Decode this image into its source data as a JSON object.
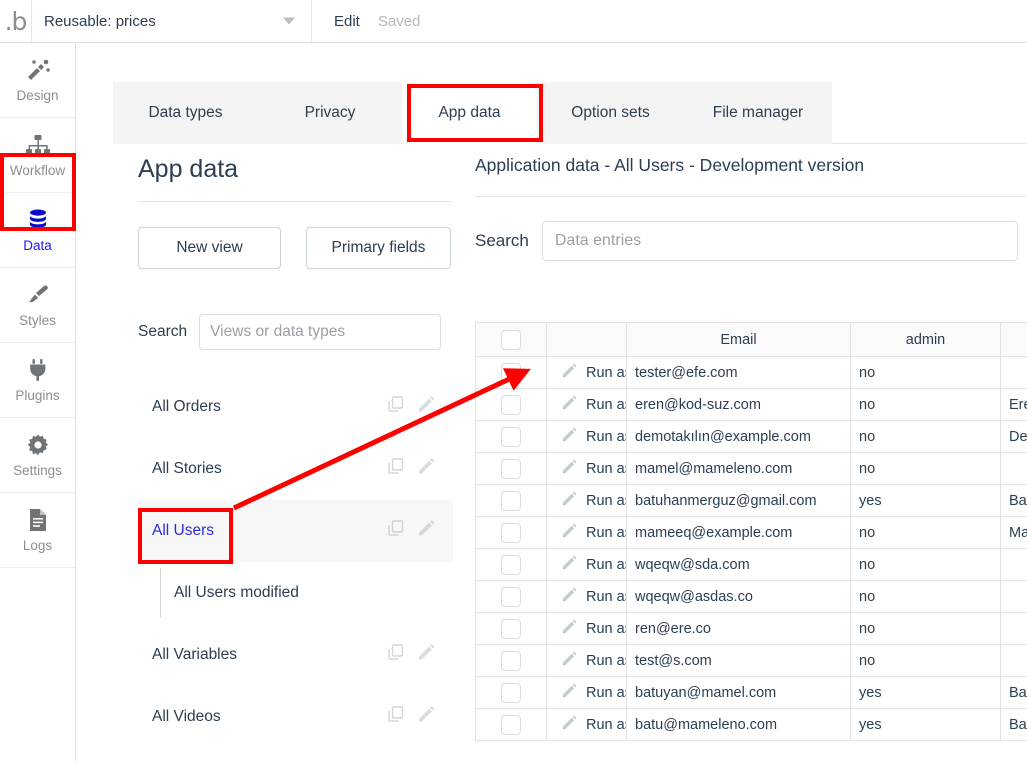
{
  "topbar": {
    "logo": "bubble-logo",
    "app_name": "Reusable: prices",
    "edit_label": "Edit",
    "saved_label": "Saved"
  },
  "sidebar": {
    "items": [
      {
        "label": "Design",
        "icon": "magic-wand-icon",
        "active": false
      },
      {
        "label": "Workflow",
        "icon": "sitemap-icon",
        "active": false
      },
      {
        "label": "Data",
        "icon": "database-icon",
        "active": true
      },
      {
        "label": "Styles",
        "icon": "paintbrush-icon",
        "active": false
      },
      {
        "label": "Plugins",
        "icon": "plug-icon",
        "active": false
      },
      {
        "label": "Settings",
        "icon": "gear-icon",
        "active": false
      },
      {
        "label": "Logs",
        "icon": "document-icon",
        "active": false
      }
    ]
  },
  "tabs": [
    {
      "label": "Data types",
      "active": false
    },
    {
      "label": "Privacy",
      "active": false
    },
    {
      "label": "App data",
      "active": true
    },
    {
      "label": "Option sets",
      "active": false
    },
    {
      "label": "File manager",
      "active": false
    }
  ],
  "left_panel": {
    "title": "App data",
    "new_view_label": "New view",
    "primary_fields_label": "Primary fields",
    "search_label": "Search",
    "search_placeholder": "Views or data types",
    "search_value": "",
    "views": [
      {
        "name": "All Orders",
        "selected": false,
        "sub": null
      },
      {
        "name": "All Stories",
        "selected": false,
        "sub": null
      },
      {
        "name": "All Users",
        "selected": true,
        "sub": "All Users modified"
      },
      {
        "name": "All Variables",
        "selected": false,
        "sub": null
      },
      {
        "name": "All Videos",
        "selected": false,
        "sub": null
      }
    ]
  },
  "right_panel": {
    "title": "Application data - All Users - Development version",
    "search_label": "Search",
    "search_placeholder": "Data entries",
    "search_value": ""
  },
  "table": {
    "headers": [
      "",
      "",
      "Email",
      "admin",
      ""
    ],
    "run_as_label": "Run as →",
    "rows": [
      {
        "email": "tester@efe.com",
        "admin": "no",
        "name": ""
      },
      {
        "email": "eren@kod-suz.com",
        "admin": "no",
        "name": "Ere"
      },
      {
        "email": "demotakılın@example.com",
        "admin": "no",
        "name": "Dem"
      },
      {
        "email": "mamel@mameleno.com",
        "admin": "no",
        "name": ""
      },
      {
        "email": "batuhanmerguz@gmail.com",
        "admin": "yes",
        "name": "Bat"
      },
      {
        "email": "mameeq@example.com",
        "admin": "no",
        "name": "Ma"
      },
      {
        "email": "wqeqw@sda.com",
        "admin": "no",
        "name": ""
      },
      {
        "email": "wqeqw@asdas.co",
        "admin": "no",
        "name": ""
      },
      {
        "email": "ren@ere.co",
        "admin": "no",
        "name": ""
      },
      {
        "email": "test@s.com",
        "admin": "no",
        "name": ""
      },
      {
        "email": "batuyan@mamel.com",
        "admin": "yes",
        "name": "Bat"
      },
      {
        "email": "batu@mameleno.com",
        "admin": "yes",
        "name": "Bat"
      }
    ]
  },
  "annotations": {
    "highlight_color": "#ff0000",
    "boxes": [
      "sidebar-data-item",
      "tab-app-data",
      "view-all-users"
    ],
    "arrow": "points from All Users view item to first row edit pencil"
  }
}
